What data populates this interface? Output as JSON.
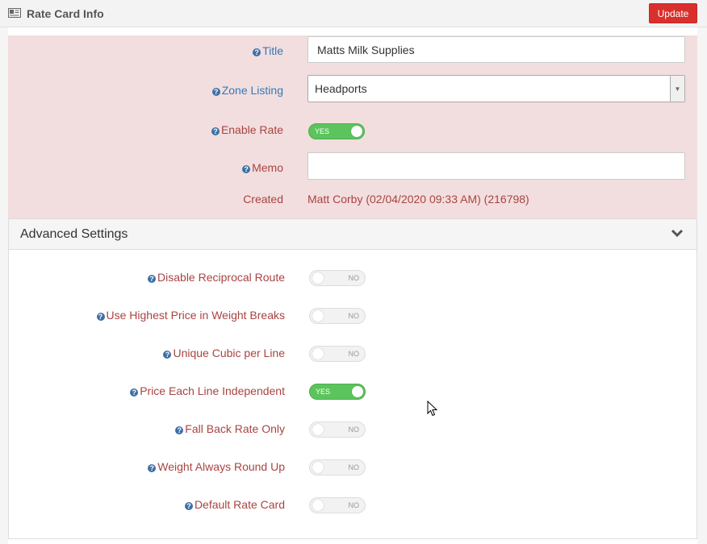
{
  "header": {
    "title": "Rate Card Info",
    "update_label": "Update",
    "icon": "id-card-icon"
  },
  "form": {
    "title": {
      "label": "Title",
      "value": "Matts Milk Supplies"
    },
    "zone_listing": {
      "label": "Zone Listing",
      "selected": "Headports"
    },
    "enable_rate": {
      "label": "Enable Rate",
      "state": "YES"
    },
    "memo": {
      "label": "Memo",
      "value": ""
    },
    "created": {
      "label": "Created",
      "value": "Matt Corby (02/04/2020 09:33 AM) (216798)"
    }
  },
  "advanced": {
    "title": "Advanced Settings",
    "settings": [
      {
        "label": "Disable Reciprocal Route",
        "state": "NO"
      },
      {
        "label": "Use Highest Price in Weight Breaks",
        "state": "NO"
      },
      {
        "label": "Unique Cubic per Line",
        "state": "NO"
      },
      {
        "label": "Price Each Line Independent",
        "state": "YES"
      },
      {
        "label": "Fall Back Rate Only",
        "state": "NO"
      },
      {
        "label": "Weight Always Round Up",
        "state": "NO"
      },
      {
        "label": "Default Rate Card",
        "state": "NO"
      }
    ]
  },
  "colors": {
    "update_button": "#d9302c",
    "error_background": "#f2dede",
    "error_text": "#a94442",
    "link_blue": "#337ab7",
    "toggle_on": "#5cc45c"
  }
}
